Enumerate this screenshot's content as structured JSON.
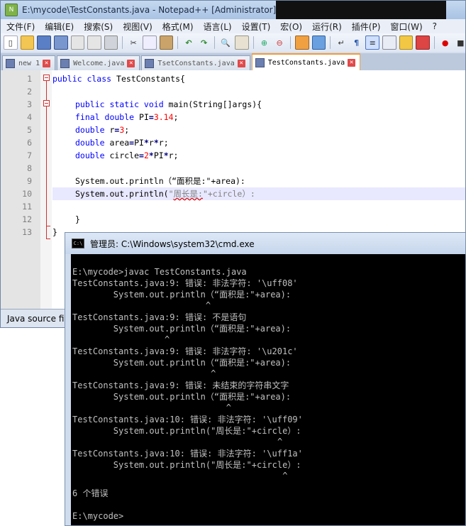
{
  "notepad": {
    "title": "E:\\mycode\\TestConstants.java - Notepad++ [Administrator]",
    "menu": [
      "文件(F)",
      "编辑(E)",
      "搜索(S)",
      "视图(V)",
      "格式(M)",
      "语言(L)",
      "设置(T)",
      "宏(O)",
      "运行(R)",
      "插件(P)",
      "窗口(W)",
      "?"
    ],
    "tabs": [
      {
        "label": "new  1"
      },
      {
        "label": "Welcome.java"
      },
      {
        "label": "TsetConstants.java"
      },
      {
        "label": "TestConstants.java"
      }
    ],
    "line_numbers": [
      "1",
      "2",
      "3",
      "4",
      "5",
      "6",
      "7",
      "8",
      "9",
      "10",
      "11",
      "12",
      "13"
    ],
    "code": {
      "l1_kw": "public class",
      "l1_rest": " TestConstants{",
      "l3_kw": "public static void",
      "l3_rest": " main(String[]args){",
      "l4_kw": "final double",
      "l4_a": " PI",
      "l4_op": "=",
      "l4_num": "3.14",
      "l4_end": ";",
      "l5_kw": "double",
      "l5_a": " r",
      "l5_op": "=",
      "l5_num": "3",
      "l5_end": ";",
      "l6_kw": "double",
      "l6_a": " area",
      "l6_op": "=",
      "l6_b": "PI",
      "l6_op2": "*",
      "l6_c": "r",
      "l6_op3": "*",
      "l6_d": "r;",
      "l7_kw": "double",
      "l7_a": " circle",
      "l7_op": "=",
      "l7_num": "2",
      "l7_op2": "*",
      "l7_b": "PI",
      "l7_op3": "*",
      "l7_c": "r;",
      "l9": "System.out.println（“面积是:\"+area):",
      "l10_a": "System.out.println(",
      "l10_str": "\"",
      "l10_sq": "周长是:",
      "l10_b": "\"+circle）:",
      "l12": "}",
      "l13": "}"
    },
    "status": "Java source fil"
  },
  "cmd": {
    "title": "管理员: C:\\Windows\\system32\\cmd.exe",
    "lines": [
      "",
      "E:\\mycode>javac TestConstants.java",
      "TestConstants.java:9: 错误: 非法字符: '\\uff08'",
      "        System.out.println（“面积是:\"+area):",
      "                          ^",
      "TestConstants.java:9: 错误: 不是语句",
      "        System.out.println（“面积是:\"+area):",
      "                  ^",
      "TestConstants.java:9: 错误: 非法字符: '\\u201c'",
      "        System.out.println（“面积是:\"+area):",
      "                           ^",
      "TestConstants.java:9: 错误: 未结束的字符串文字",
      "        System.out.println（“面积是:\"+area):",
      "                              ^",
      "TestConstants.java:10: 错误: 非法字符: '\\uff09'",
      "        System.out.println(\"周长是:\"+circle）:",
      "                                        ^",
      "TestConstants.java:10: 错误: 非法字符: '\\uff1a'",
      "        System.out.println(\"周长是:\"+circle）:",
      "                                         ^",
      "",
      "6 个错误",
      "",
      "E:\\mycode>"
    ]
  }
}
